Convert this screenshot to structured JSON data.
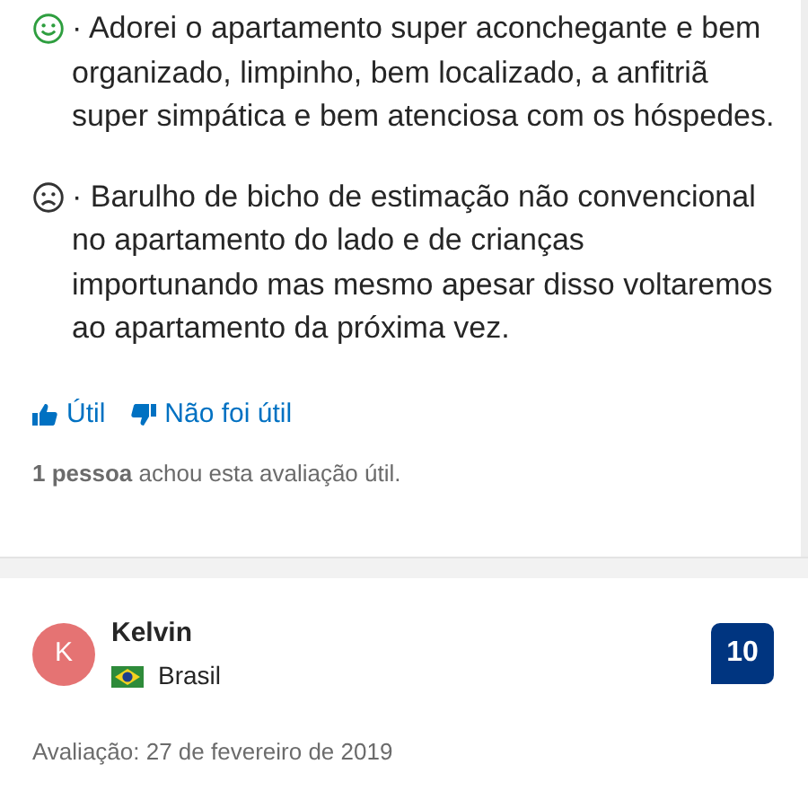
{
  "review": {
    "comments": [
      {
        "kind": "positive",
        "text": "· Adorei o apartamento super aconchegante e bem organizado, limpinho, bem localizado, a anfitriã super simpática e bem atenciosa com os hóspedes."
      },
      {
        "kind": "negative",
        "text": "· Barulho de bicho de estimação não convencional no apartamento do lado e de crianças importunando mas mesmo apesar disso voltaremos ao apartamento da próxima vez."
      }
    ],
    "helpful_button": "Útil",
    "not_helpful_button": "Não foi útil",
    "helpful_count": "**1 pessoa** achou esta avaliação útil."
  },
  "next_review": {
    "avatar_letter": "K",
    "name": "Kelvin",
    "country": "Brasil",
    "score": "10",
    "date": "Avaliação: 27 de fevereiro de 2019"
  }
}
